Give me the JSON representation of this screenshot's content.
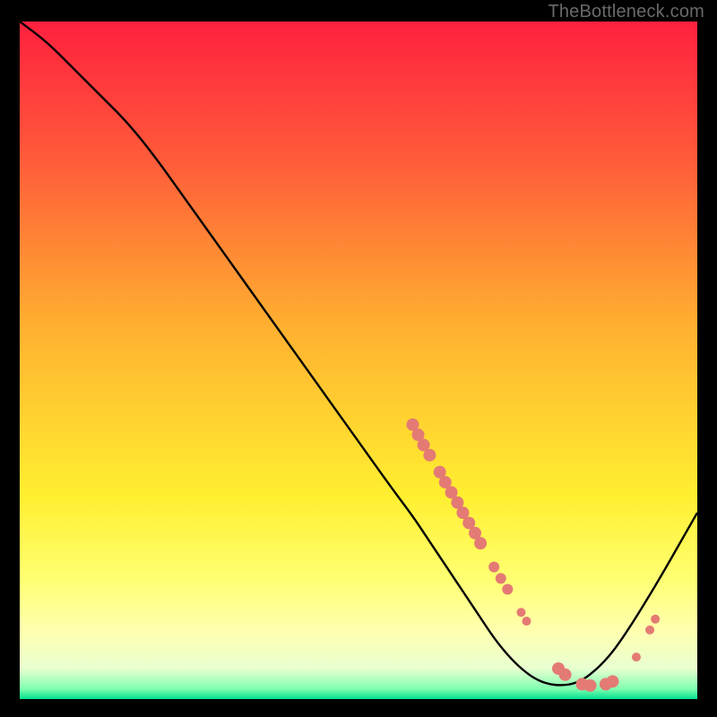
{
  "watermark": "TheBottleneck.com",
  "chart_data": {
    "type": "line",
    "title": "",
    "xlabel": "",
    "ylabel": "",
    "xlim": [
      0,
      100
    ],
    "ylim": [
      0,
      100
    ],
    "grid": false,
    "legend": false,
    "background": {
      "type": "vertical-gradient",
      "stops": [
        {
          "offset": 0.0,
          "color": "#ff203f"
        },
        {
          "offset": 0.2,
          "color": "#ff5a3a"
        },
        {
          "offset": 0.45,
          "color": "#ffb030"
        },
        {
          "offset": 0.7,
          "color": "#ffef30"
        },
        {
          "offset": 0.82,
          "color": "#ffff70"
        },
        {
          "offset": 0.9,
          "color": "#ffffb0"
        },
        {
          "offset": 0.955,
          "color": "#e8ffd0"
        },
        {
          "offset": 0.985,
          "color": "#80ffb0"
        },
        {
          "offset": 1.0,
          "color": "#00e090"
        }
      ]
    },
    "series": [
      {
        "name": "bottleneck-curve",
        "color": "#000000",
        "x": [
          0,
          4,
          8,
          12,
          16,
          20,
          25,
          30,
          35,
          40,
          45,
          50,
          55,
          58,
          60,
          62,
          64,
          66,
          68,
          70,
          72,
          74,
          76,
          78,
          80,
          82,
          84,
          87,
          90,
          94,
          98,
          100
        ],
        "y": [
          100,
          97,
          93,
          89,
          85,
          80,
          73,
          66,
          59,
          52,
          45,
          38,
          31,
          27,
          24,
          21,
          18,
          15,
          12,
          9,
          6.5,
          4.5,
          3.0,
          2.2,
          2.0,
          2.3,
          3.4,
          6.2,
          10.5,
          17.0,
          24.0,
          27.5
        ]
      }
    ],
    "markers": {
      "color": "#e47a74",
      "radius_default": 7,
      "points": [
        {
          "x": 58.0,
          "y": 40.5,
          "r": 7
        },
        {
          "x": 58.8,
          "y": 39.0,
          "r": 7
        },
        {
          "x": 59.6,
          "y": 37.5,
          "r": 7
        },
        {
          "x": 60.5,
          "y": 36.0,
          "r": 7
        },
        {
          "x": 62.0,
          "y": 33.5,
          "r": 7
        },
        {
          "x": 62.8,
          "y": 32.0,
          "r": 7
        },
        {
          "x": 63.7,
          "y": 30.5,
          "r": 7
        },
        {
          "x": 64.6,
          "y": 29.0,
          "r": 7
        },
        {
          "x": 65.4,
          "y": 27.5,
          "r": 7
        },
        {
          "x": 66.3,
          "y": 26.0,
          "r": 7
        },
        {
          "x": 67.2,
          "y": 24.5,
          "r": 7
        },
        {
          "x": 68.0,
          "y": 23.0,
          "r": 7
        },
        {
          "x": 70.0,
          "y": 19.5,
          "r": 6
        },
        {
          "x": 71.0,
          "y": 17.8,
          "r": 6
        },
        {
          "x": 72.0,
          "y": 16.2,
          "r": 6
        },
        {
          "x": 74.0,
          "y": 12.8,
          "r": 5
        },
        {
          "x": 74.8,
          "y": 11.5,
          "r": 5
        },
        {
          "x": 79.5,
          "y": 4.5,
          "r": 7
        },
        {
          "x": 80.5,
          "y": 3.6,
          "r": 7
        },
        {
          "x": 83.0,
          "y": 2.2,
          "r": 7
        },
        {
          "x": 84.2,
          "y": 2.0,
          "r": 7
        },
        {
          "x": 86.5,
          "y": 2.2,
          "r": 7
        },
        {
          "x": 87.5,
          "y": 2.6,
          "r": 7
        },
        {
          "x": 91.0,
          "y": 6.2,
          "r": 5
        },
        {
          "x": 93.0,
          "y": 10.2,
          "r": 5
        },
        {
          "x": 93.8,
          "y": 11.8,
          "r": 5
        }
      ]
    }
  }
}
